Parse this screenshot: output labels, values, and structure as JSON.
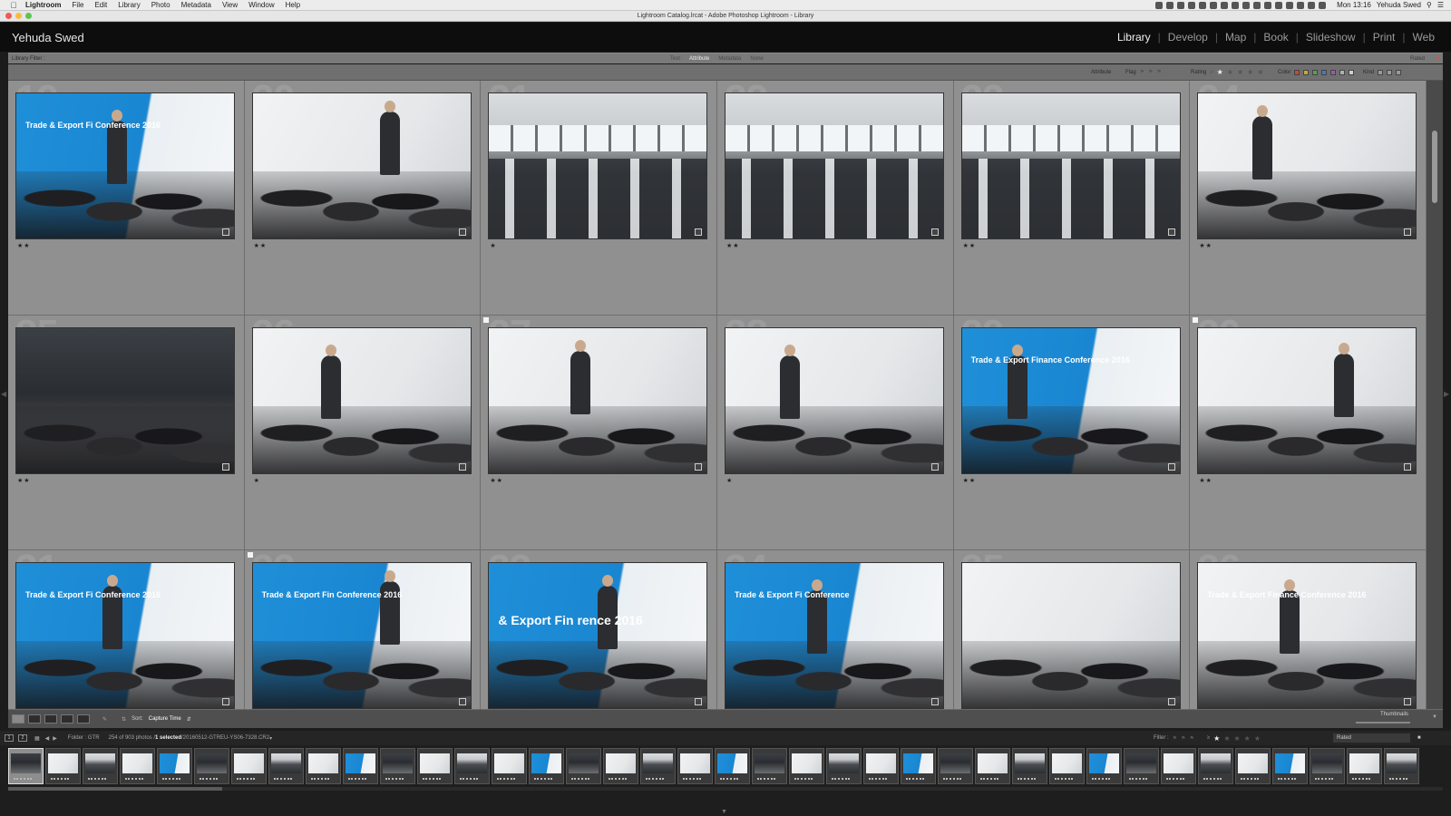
{
  "menubar": {
    "app": "Lightroom",
    "items": [
      "File",
      "Edit",
      "Library",
      "Photo",
      "Metadata",
      "View",
      "Window",
      "Help"
    ],
    "clock": "Mon 13:16",
    "user": "Yehuda Swed"
  },
  "window": {
    "title": "Lightroom Catalog.lrcat - Adobe Photoshop Lightroom - Library"
  },
  "identity": {
    "plate": "Yehuda Swed",
    "modules": [
      "Library",
      "Develop",
      "Map",
      "Book",
      "Slideshow",
      "Print",
      "Web"
    ],
    "active_module": "Library"
  },
  "filter": {
    "label": "Library Filter :",
    "tabs": [
      "Text",
      "Attribute",
      "Metadata",
      "None"
    ],
    "active_tab": "Attribute",
    "preset": "Rated",
    "attribute_label": "Attribute",
    "flag_label": "Flag",
    "rating_label": "Rating",
    "color_label": "Color",
    "kind_label": "Kind",
    "rating_filter_value": 1,
    "color_swatches": [
      "#c44a3a",
      "#c8a83a",
      "#5aa050",
      "#4a78c0",
      "#9a5ab0",
      "#b0b0b0",
      "#d0d0d0"
    ]
  },
  "grid": {
    "cells": [
      {
        "num": "19",
        "stars": "★★",
        "style": "ph-blue",
        "text": "Trade & Export Fi Conference 2016",
        "flag": false
      },
      {
        "num": "20",
        "stars": "★★",
        "style": "ph-white",
        "text": "",
        "flag": false
      },
      {
        "num": "21",
        "stars": "★",
        "style": "ph-room",
        "text": "",
        "flag": false
      },
      {
        "num": "22",
        "stars": "★★",
        "style": "ph-room",
        "text": "",
        "flag": false
      },
      {
        "num": "23",
        "stars": "★★",
        "style": "ph-room",
        "text": "",
        "flag": false
      },
      {
        "num": "24",
        "stars": "★★",
        "style": "ph-white",
        "text": "",
        "flag": false
      },
      {
        "num": "25",
        "stars": "★★",
        "style": "ph-crowd",
        "text": "",
        "flag": false
      },
      {
        "num": "26",
        "stars": "★",
        "style": "ph-white",
        "text": "",
        "flag": false
      },
      {
        "num": "27",
        "stars": "★★",
        "style": "ph-white",
        "text": "",
        "flag": true
      },
      {
        "num": "28",
        "stars": "★",
        "style": "ph-white",
        "text": "",
        "flag": false
      },
      {
        "num": "29",
        "stars": "★★",
        "style": "ph-blue",
        "text": "Trade & Export Finance Conference 2016",
        "flag": false
      },
      {
        "num": "30",
        "stars": "★★",
        "style": "ph-white",
        "text": "",
        "flag": true
      },
      {
        "num": "31",
        "stars": "",
        "style": "ph-blue",
        "text": "Trade & Export Fi Conference 2016",
        "flag": false
      },
      {
        "num": "32",
        "stars": "",
        "style": "ph-blue",
        "text": "Trade & Export Fin Conference 2016",
        "flag": true
      },
      {
        "num": "33",
        "stars": "",
        "style": "ph-blue",
        "text": "& Export Fin rence 2016",
        "flag": false
      },
      {
        "num": "34",
        "stars": "",
        "style": "ph-blue",
        "text": "Trade & Export Fi Conference",
        "flag": false
      },
      {
        "num": "35",
        "stars": "",
        "style": "ph-white",
        "text": "",
        "flag": false
      },
      {
        "num": "36",
        "stars": "",
        "style": "ph-white",
        "text": "Trade & Export Finance Conference 2016",
        "flag": false
      }
    ]
  },
  "toolbar": {
    "sort_label": "Sort:",
    "sort_value": "Capture Time",
    "thumbnails_label": "Thumbnails"
  },
  "filmstrip": {
    "page1": "1",
    "page2": "2",
    "folder": "Folder : GTR",
    "count": "254 of 903 photos /",
    "selected": "1 selected",
    "filename": "/20160512-GTREU-YS06-7328.CR2",
    "filter_label": "Filter :",
    "preset": "Rated",
    "frames": 38
  }
}
